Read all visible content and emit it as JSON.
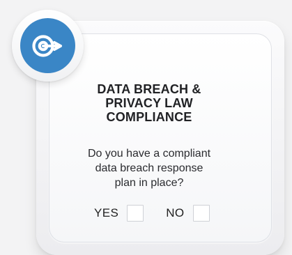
{
  "colors": {
    "background": "#f3f3f4",
    "icon_blue": "#3a86c6",
    "text": "#202124"
  },
  "icon": {
    "name": "target-arrow-icon"
  },
  "card": {
    "title_lines": [
      "DATA BREACH &",
      "PRIVACY LAW",
      "COMPLIANCE"
    ],
    "question_lines": [
      "Do you have a compliant",
      "data breach response",
      "plan in place?"
    ],
    "options": [
      {
        "label": "YES",
        "checked": false
      },
      {
        "label": "NO",
        "checked": false
      }
    ]
  }
}
